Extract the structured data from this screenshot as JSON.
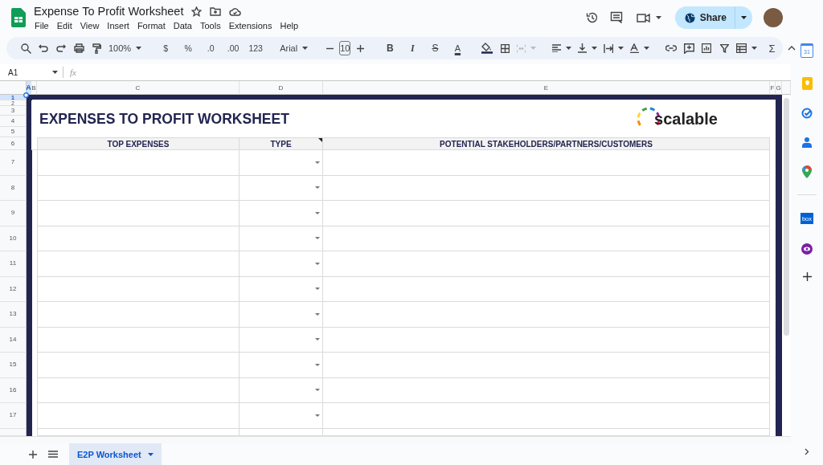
{
  "document": {
    "title": "Expense To Profit Worksheet"
  },
  "menu": [
    "File",
    "Edit",
    "View",
    "Insert",
    "Format",
    "Data",
    "Tools",
    "Extensions",
    "Help"
  ],
  "share_button": {
    "label": "Share"
  },
  "toolbar": {
    "zoom": "100%",
    "currency": "$",
    "percent": "%",
    "decrease_decimal": ".0",
    "increase_decimal": ".00",
    "more_formats": "123",
    "font": "Arial",
    "font_size": "10",
    "bold": "B",
    "italic": "I",
    "strikethrough": "S",
    "text_color": "A",
    "merge_cells": {
      "disabled": true
    },
    "function": "Σ"
  },
  "formula_bar": {
    "cell_reference": "A1",
    "function_label": "fx"
  },
  "columns": [
    {
      "label": "A",
      "selected": true
    },
    {
      "label": "B",
      "selected": false
    },
    {
      "label": "C",
      "selected": false
    },
    {
      "label": "D",
      "selected": false
    },
    {
      "label": "E",
      "selected": false
    },
    {
      "label": "F",
      "selected": false
    },
    {
      "label": "G",
      "selected": false
    }
  ],
  "rows": [
    {
      "label": "1",
      "selected": true
    },
    {
      "label": "2",
      "selected": false
    },
    {
      "label": "3",
      "selected": false
    },
    {
      "label": "4",
      "selected": false
    },
    {
      "label": "5",
      "selected": false
    },
    {
      "label": "6",
      "selected": false
    },
    {
      "label": "7",
      "selected": false
    },
    {
      "label": "8",
      "selected": false
    },
    {
      "label": "9",
      "selected": false
    },
    {
      "label": "10",
      "selected": false
    },
    {
      "label": "11",
      "selected": false
    },
    {
      "label": "12",
      "selected": false
    },
    {
      "label": "13",
      "selected": false
    },
    {
      "label": "14",
      "selected": false
    },
    {
      "label": "15",
      "selected": false
    },
    {
      "label": "16",
      "selected": false
    },
    {
      "label": "17",
      "selected": false
    }
  ],
  "worksheet": {
    "title": "EXPENSES TO PROFIT WORKSHEET",
    "logo": "scalable",
    "headers": [
      "TOP EXPENSES",
      "TYPE",
      "POTENTIAL STAKEHOLDERS/PARTNERS/CUSTOMERS"
    ]
  },
  "side_panel": {
    "calendar_day": "31",
    "box_logo": "box"
  },
  "sheet_tabs": [
    {
      "label": "E2P Worksheet",
      "selected": true
    }
  ]
}
